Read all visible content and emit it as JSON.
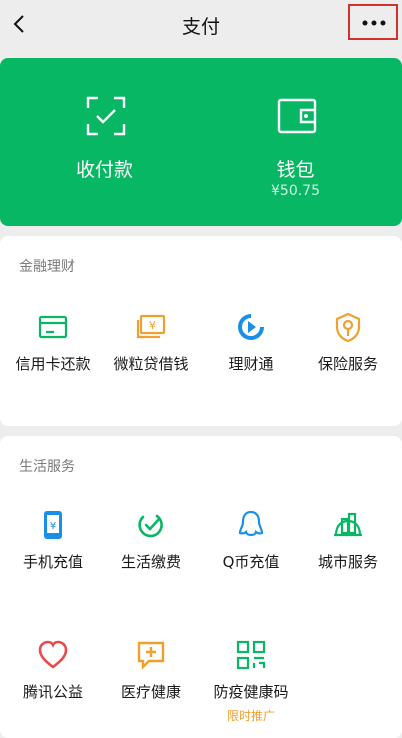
{
  "header": {
    "title": "支付"
  },
  "green_panel": {
    "collect": {
      "label": "收付款"
    },
    "wallet": {
      "label": "钱包",
      "balance": "¥50.75"
    }
  },
  "finance": {
    "title": "金融理财",
    "items": [
      {
        "label": "信用卡还款",
        "icon": "credit-card-icon"
      },
      {
        "label": "微粒贷借钱",
        "icon": "cash-icon"
      },
      {
        "label": "理财通",
        "icon": "wealth-icon"
      },
      {
        "label": "保险服务",
        "icon": "insurance-icon"
      }
    ]
  },
  "life": {
    "title": "生活服务",
    "items": [
      {
        "label": "手机充值",
        "icon": "phone-icon"
      },
      {
        "label": "生活缴费",
        "icon": "bill-check-icon"
      },
      {
        "label": "Q币充值",
        "icon": "penguin-icon"
      },
      {
        "label": "城市服务",
        "icon": "city-icon"
      },
      {
        "label": "腾讯公益",
        "icon": "heart-icon"
      },
      {
        "label": "医疗健康",
        "icon": "medical-icon"
      },
      {
        "label": "防疫健康码",
        "icon": "qr-code-icon",
        "tag": "限时推广"
      }
    ]
  },
  "colors": {
    "brand_green": "#07b764",
    "blue": "#1a8fe8",
    "orange": "#f0a030",
    "red": "#e74c4c",
    "highlight_border": "#d0332e"
  }
}
